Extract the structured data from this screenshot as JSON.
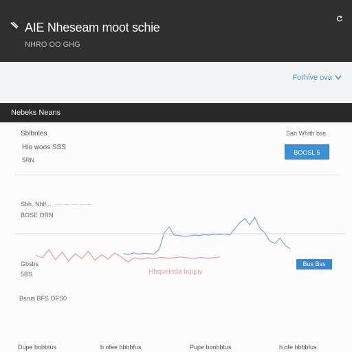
{
  "header": {
    "title": "AIE Nheseam moot schie",
    "subtitle": "NHRO OO GHG",
    "menu_icon": "menu-icon",
    "right_icon": "refresh-icon"
  },
  "toolbar": {
    "link_label": "Forhive ova"
  },
  "section": {
    "title": "Nebeks Neans"
  },
  "panel": {
    "left_top_label": "Sblbnles",
    "left_value": "Hio woos SSS",
    "left_sub": "5RN",
    "right_top_label": "Sah Whith bss",
    "primary_button": "BOOSL 5"
  },
  "chart": {
    "label_1": "Sbh. Nhlf...",
    "label_1_suffix": "— — — ——",
    "label_2": "BOSE ORN",
    "label_3": "Gbsbs",
    "label_4": "5BS",
    "annotation": "Hbqueinda bqquy",
    "button": "Bus Bss",
    "caption": "Bsrus BFS OFS0"
  },
  "footer": {
    "items": [
      "Dupe bobbtus",
      "b  ofee bbbbfus",
      "Pupe boobbtus",
      "h  ofe bbbbfus"
    ]
  },
  "colors": {
    "header_bg": "#2f2f2f",
    "accent": "#3d8fd6",
    "line_blue": "#7ea7d8",
    "line_red": "#f29a9a"
  },
  "chart_data": {
    "type": "line",
    "series": [
      {
        "values": [
          56,
          50,
          70,
          45,
          64,
          42,
          60,
          48,
          66,
          44,
          58,
          47,
          62,
          52,
          40,
          50,
          47,
          50,
          48,
          51,
          49,
          50,
          52,
          50,
          48,
          51,
          49,
          50,
          52
        ]
      },
      {
        "values": [
          10,
          8,
          12,
          9,
          11,
          10,
          9,
          20,
          60,
          75,
          55,
          54,
          52,
          53,
          55,
          54,
          56,
          55,
          57,
          56,
          58,
          55,
          70,
          85,
          95,
          80,
          98,
          72,
          60,
          40,
          35,
          48,
          30,
          22
        ]
      }
    ]
  }
}
